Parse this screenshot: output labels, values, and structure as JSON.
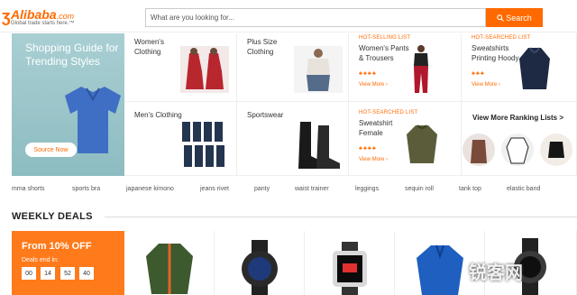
{
  "header": {
    "logo_text": "Alibaba",
    "logo_suffix": ".com",
    "tagline": "Global trade starts here.™",
    "search_placeholder": "What are you looking for...",
    "search_button": "Search"
  },
  "banner": {
    "title": "Shopping Guide for Trending Styles",
    "button": "Source Now"
  },
  "categories": {
    "womens": "Women's Clothing",
    "plus": "Plus Size Clothing",
    "mens": "Men's Clothing",
    "sports": "Sportswear"
  },
  "ranking": {
    "hot_selling_list": "HOT-SELLING LIST",
    "hot_searched_list": "HOT-SEARCHED LIST",
    "womens_pants": "Women's Pants & Trousers",
    "sweatshirts_hoody": "Sweatshirts Printing Hoody",
    "sweatshirt_female": "Sweatshirt Female",
    "view_more": "View More",
    "view_more_ranking": "View More Ranking Lists >"
  },
  "keywords": [
    "mma shorts",
    "sports bra",
    "japanese kimono",
    "jeans rivet",
    "panty",
    "waist trainer",
    "leggings",
    "sequin roll",
    "tank top",
    "elastic band"
  ],
  "weekly_deals": {
    "title": "WEEKLY DEALS",
    "discount": "From 10% OFF",
    "ends_in": "Deals end in:",
    "countdown": [
      "00",
      "14",
      "52",
      "40"
    ]
  },
  "watermark": "锐客网",
  "colors": {
    "accent": "#ff6a00"
  }
}
